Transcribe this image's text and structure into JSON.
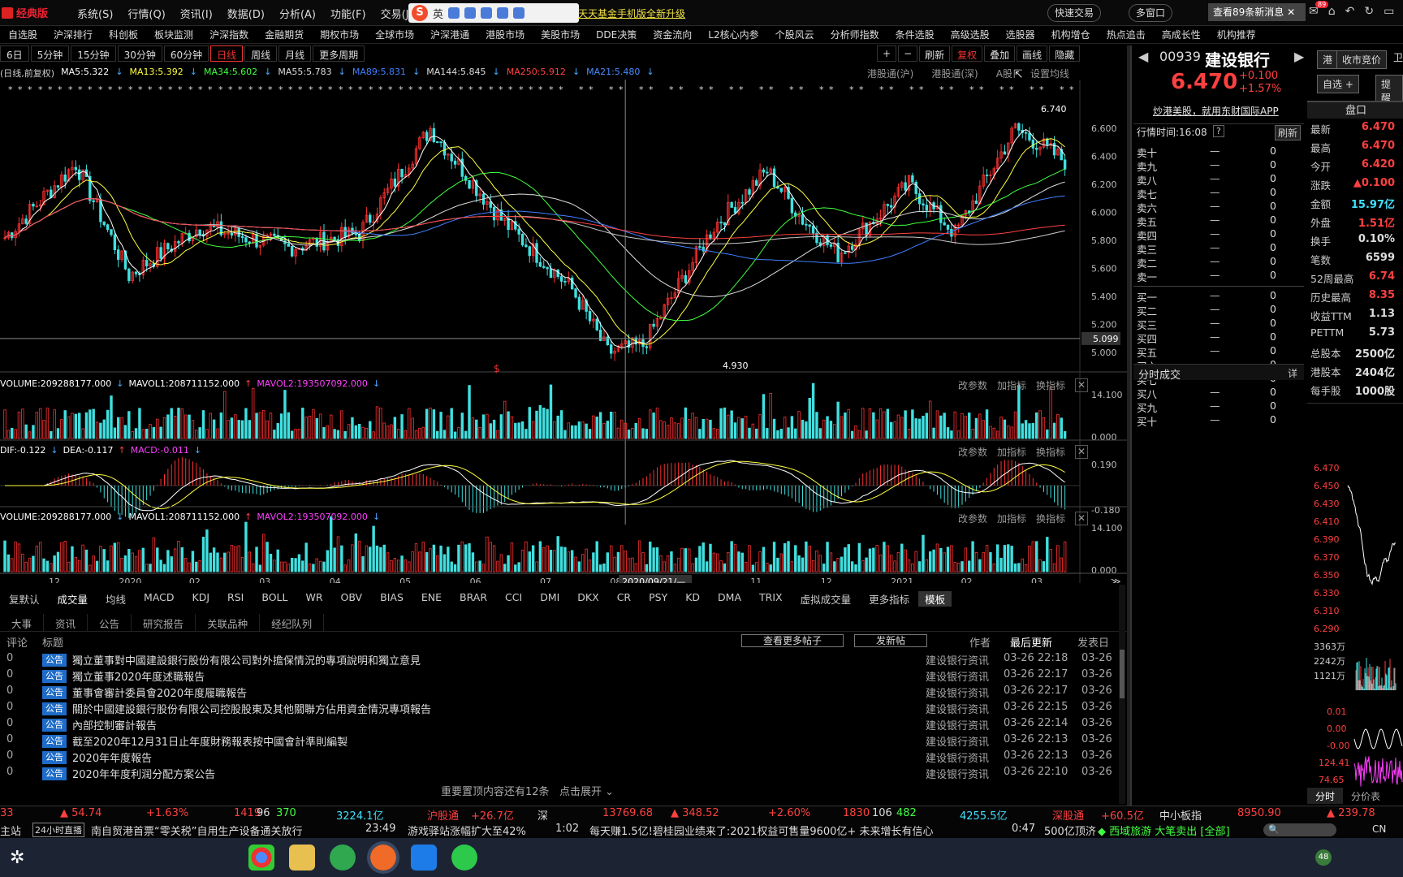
{
  "app": {
    "logo": "经典版",
    "menu": [
      "系统(S)",
      "行情(Q)",
      "资讯(I)",
      "数据(D)",
      "分析(A)",
      "功能(F)",
      "交易(J)"
    ],
    "ime_label": "英",
    "promo": "天天基金手机版全新升级",
    "quick_trade": "快速交易",
    "multi_window": "多窗口",
    "messages": "查看89条新消息",
    "msg_badge": "89"
  },
  "nav2": [
    "自选股",
    "沪深排行",
    "科创板",
    "板块监测",
    "沪深指数",
    "金融期货",
    "期权市场",
    "全球市场",
    "沪深港通",
    "港股市场",
    "美股市场",
    "DDE决策",
    "资金流向",
    "L2核心内参",
    "个股风云",
    "分析师指数",
    "条件选股",
    "高级选股",
    "选股器",
    "机构增仓",
    "热点追击",
    "高成长性",
    "机构推荐"
  ],
  "timeframes": [
    "6日",
    "5分钟",
    "15分钟",
    "30分钟",
    "60分钟",
    "日线",
    "周线",
    "月线",
    "更多周期"
  ],
  "active_tf": "日线",
  "chart_tools": [
    "刷新",
    "复权",
    "叠加",
    "画线",
    "隐藏"
  ],
  "ma_header": {
    "prefix": "(日线,前复权)",
    "items": [
      {
        "t": "MA5:5.322",
        "c": "#ffffff"
      },
      {
        "t": "MA13:5.392",
        "c": "#ffff40"
      },
      {
        "t": "MA34:5.602",
        "c": "#40ff40"
      },
      {
        "t": "MA55:5.783",
        "c": "#dddddd"
      },
      {
        "t": "MA89:5.831",
        "c": "#4080ff"
      },
      {
        "t": "MA144:5.845",
        "c": "#dddddd"
      },
      {
        "t": "MA250:5.912",
        "c": "#ff4040"
      },
      {
        "t": "MA21:5.480",
        "c": "#4a8cff"
      }
    ]
  },
  "chart_links": [
    "港股通(沪)",
    "港股通(深)",
    "A股",
    "设置均线"
  ],
  "chart_data": {
    "type": "candlestick",
    "ylim": [
      4.93,
      6.74
    ],
    "yticks": [
      "6.600",
      "6.400",
      "6.200",
      "6.000",
      "5.800",
      "5.600",
      "5.400",
      "5.200",
      "5.000"
    ],
    "crosshair_price": "5.099",
    "high_label": "6.740",
    "low_label": "4.930",
    "xlabels": [
      "12",
      "2020",
      "02",
      "03",
      "04",
      "05",
      "06",
      "07",
      "08",
      "09",
      "11",
      "12",
      "2021",
      "02",
      "03"
    ],
    "cursor_date": "2020/09/21/—",
    "anchor_path": [
      [
        0,
        5.82
      ],
      [
        20,
        6.35
      ],
      [
        35,
        5.55
      ],
      [
        55,
        5.9
      ],
      [
        80,
        5.75
      ],
      [
        100,
        5.85
      ],
      [
        120,
        6.6
      ],
      [
        140,
        5.95
      ],
      [
        160,
        5.45
      ],
      [
        170,
        5.0
      ],
      [
        180,
        5.05
      ],
      [
        200,
        5.9
      ],
      [
        215,
        6.3
      ],
      [
        225,
        5.95
      ],
      [
        235,
        5.7
      ],
      [
        255,
        6.2
      ],
      [
        268,
        5.85
      ],
      [
        285,
        6.6
      ],
      [
        300,
        6.35
      ]
    ]
  },
  "vol_panel": {
    "labels": [
      {
        "t": "VOLUME:209288177.000",
        "c": "#ffffff"
      },
      {
        "t": "MAVOL1:208711152.000",
        "c": "#ffffff"
      },
      {
        "t": "MAVOL2:193507092.000",
        "c": "#ff40ff"
      }
    ],
    "ymax": "14.100",
    "ymin": "0.000"
  },
  "macd_panel": {
    "labels": [
      {
        "t": "DIF:-0.122",
        "c": "#ffffff"
      },
      {
        "t": "DEA:-0.117",
        "c": "#ffffff"
      },
      {
        "t": "MACD:-0.011",
        "c": "#ff40ff"
      }
    ],
    "ymax": "0.190",
    "ymin": "-0.180",
    "prefix": ",26,9)"
  },
  "panel_links": [
    "改参数",
    "加指标",
    "换指标"
  ],
  "indicator_tabs": [
    "复默认",
    "成交量",
    "均线",
    "MACD",
    "KDJ",
    "RSI",
    "BOLL",
    "WR",
    "OBV",
    "BIAS",
    "ENE",
    "BRAR",
    "CCI",
    "DMI",
    "DKX",
    "CR",
    "PSY",
    "KD",
    "DMA",
    "TRIX",
    "虚拟成交量",
    "更多指标",
    "模板"
  ],
  "news_tabs": [
    "大事",
    "资讯",
    "公告",
    "研究报告",
    "关联品种",
    "经纪队列"
  ],
  "news_header": {
    "c1": "评论",
    "c2": "标题",
    "btn1": "查看更多帖子",
    "btn2": "发新帖",
    "c3": "作者",
    "c4": "最后更新",
    "c5": "发表日"
  },
  "news": [
    {
      "n": "0",
      "tag": "公告",
      "title": "獨立董事對中國建設銀行股份有限公司對外擔保情況的專項說明和獨立意見",
      "author": "建设银行资讯",
      "upd": "03-26 22:18",
      "pub": "03-26"
    },
    {
      "n": "0",
      "tag": "公告",
      "title": "獨立董事2020年度述職報告",
      "author": "建设银行资讯",
      "upd": "03-26 22:17",
      "pub": "03-26"
    },
    {
      "n": "0",
      "tag": "公告",
      "title": "董事會審計委員會2020年度履職報告",
      "author": "建设银行资讯",
      "upd": "03-26 22:17",
      "pub": "03-26"
    },
    {
      "n": "0",
      "tag": "公告",
      "title": "關於中國建設銀行股份有限公司控股股東及其他關聯方佔用資金情況專項報告",
      "author": "建设银行资讯",
      "upd": "03-26 22:15",
      "pub": "03-26"
    },
    {
      "n": "0",
      "tag": "公告",
      "title": "內部控制審計報告",
      "author": "建设银行资讯",
      "upd": "03-26 22:14",
      "pub": "03-26"
    },
    {
      "n": "0",
      "tag": "公告",
      "title": "截至2020年12月31日止年度財務報表按中國會計準則編製",
      "author": "建设银行资讯",
      "upd": "03-26 22:13",
      "pub": "03-26"
    },
    {
      "n": "0",
      "tag": "公告",
      "title": "2020年年度報告",
      "author": "建设银行资讯",
      "upd": "03-26 22:13",
      "pub": "03-26"
    },
    {
      "n": "0",
      "tag": "公告",
      "title": "2020年年度利润分配方案公告",
      "author": "建设银行资讯",
      "upd": "03-26 22:10",
      "pub": "03-26"
    }
  ],
  "news_more": "重要置顶内容还有12条",
  "news_expand": "点击展开",
  "stock": {
    "code": "00939",
    "name": "建设银行",
    "price": "6.470",
    "chg": "+0.100",
    "pct": "+1.57%",
    "hk": "港",
    "close_bid": "收市竞价",
    "watch": "自选",
    "remind": "提醒",
    "ad": "炒港美股，就用东财国际APP",
    "pankou": "盘口",
    "time_label": "行情时间:16:08",
    "refresh": "刷新"
  },
  "orderbook": {
    "sell": [
      "卖十",
      "卖九",
      "卖八",
      "卖七",
      "卖六",
      "卖五",
      "卖四",
      "卖三",
      "卖二",
      "卖一"
    ],
    "buy": [
      "买一",
      "买二",
      "买三",
      "买四",
      "买五",
      "买六",
      "买七",
      "买八",
      "买九",
      "买十"
    ],
    "dash": "—",
    "zero": "0"
  },
  "stats": [
    {
      "k": "最新",
      "v": "6.470",
      "c": "#ff4040"
    },
    {
      "k": "最高",
      "v": "6.470",
      "c": "#ff4040"
    },
    {
      "k": "今开",
      "v": "6.420",
      "c": "#ff4040"
    },
    {
      "k": "涨跌",
      "v": "▲0.100",
      "c": "#ff4040"
    },
    {
      "k": "金额",
      "v": "15.97亿",
      "c": "#40e0ff"
    },
    {
      "k": "外盘",
      "v": "1.51亿",
      "c": "#ff4040"
    },
    {
      "k": "换手",
      "v": "0.10%",
      "c": "#dddddd"
    },
    {
      "k": "笔数",
      "v": "6599",
      "c": "#dddddd"
    },
    {
      "k": "52周最高",
      "v": "6.74",
      "c": "#ff4040"
    },
    {
      "k": "历史最高",
      "v": "8.35",
      "c": "#ff4040"
    },
    {
      "k": "收益TTM",
      "v": "1.13",
      "c": "#dddddd"
    },
    {
      "k": "PETTM",
      "v": "5.73",
      "c": "#dddddd"
    },
    {
      "k": "总股本",
      "v": "2500亿",
      "c": "#dddddd"
    },
    {
      "k": "港股本",
      "v": "2404亿",
      "c": "#dddddd"
    },
    {
      "k": "每手股",
      "v": "1000股",
      "c": "#dddddd"
    }
  ],
  "fenshi": "分时成交",
  "detail": "详",
  "mini_prices": [
    "6.470",
    "6.450",
    "6.430",
    "6.410",
    "6.390",
    "6.370",
    "6.350",
    "6.330",
    "6.310",
    "6.290"
  ],
  "mini_vol": [
    "3363万",
    "2242万",
    "1121万"
  ],
  "mini_ind": [
    "0.01",
    "0.00",
    "-0.00",
    "124.41",
    "74.65",
    "24.90"
  ],
  "mini_tabs": [
    "分时",
    "分价表"
  ],
  "ticker1": [
    {
      "t": "33",
      "c": "#ff4040",
      "x": 0
    },
    {
      "t": "▲ 54.74",
      "c": "#ff4040",
      "x": 74
    },
    {
      "t": "+1.63%",
      "c": "#ff4040",
      "x": 180
    },
    {
      "t": "1419",
      "c": "#ff4040",
      "x": 288
    },
    {
      "t": "96",
      "c": "#dddddd",
      "x": 316
    },
    {
      "t": "370",
      "c": "#40ff40",
      "x": 340
    },
    {
      "t": "3224.1亿",
      "c": "#40e0ff",
      "x": 414
    },
    {
      "t": "沪股通",
      "c": "#ff4040",
      "x": 526
    },
    {
      "t": "+26.7亿",
      "c": "#ff4040",
      "x": 580
    },
    {
      "t": "深",
      "c": "#dddddd",
      "x": 662
    },
    {
      "t": "13769.68",
      "c": "#ff4040",
      "x": 742
    },
    {
      "t": "▲ 348.52",
      "c": "#ff4040",
      "x": 826
    },
    {
      "t": "+2.60%",
      "c": "#ff4040",
      "x": 946
    },
    {
      "t": "1830",
      "c": "#ff4040",
      "x": 1038
    },
    {
      "t": "106",
      "c": "#dddddd",
      "x": 1074
    },
    {
      "t": "482",
      "c": "#40ff40",
      "x": 1104
    },
    {
      "t": "4255.5亿",
      "c": "#40e0ff",
      "x": 1182
    },
    {
      "t": "深股通",
      "c": "#ff4040",
      "x": 1296
    },
    {
      "t": "+60.5亿",
      "c": "#ff4040",
      "x": 1356
    },
    {
      "t": "中小板指",
      "c": "#dddddd",
      "x": 1428
    },
    {
      "t": "8950.90",
      "c": "#ff4040",
      "x": 1524
    },
    {
      "t": "▲ 239.78",
      "c": "#ff4040",
      "x": 1634
    }
  ],
  "ticker2": [
    {
      "t": "主站",
      "x": 0
    },
    {
      "t": "24小时直播",
      "x": 40
    },
    {
      "t": "南自贸港首票“零关税”自用生产设备通关放行",
      "x": 112
    },
    {
      "t": "23:49",
      "x": 450
    },
    {
      "t": "游戏驿站涨幅扩大至42%",
      "x": 502
    },
    {
      "t": "1:02",
      "x": 684
    },
    {
      "t": "每天赚1.5亿!碧桂园业绩来了:2021权益可售量9600亿+ 未来增长有信心",
      "x": 726
    },
    {
      "t": "0:47",
      "x": 1246
    },
    {
      "t": "500亿顶济",
      "x": 1286
    },
    {
      "t": "◆ 西域旅游 大笔卖出 [全部]",
      "x": 1352
    }
  ],
  "taskbar": {
    "tray": "CN",
    "badge": "48"
  }
}
